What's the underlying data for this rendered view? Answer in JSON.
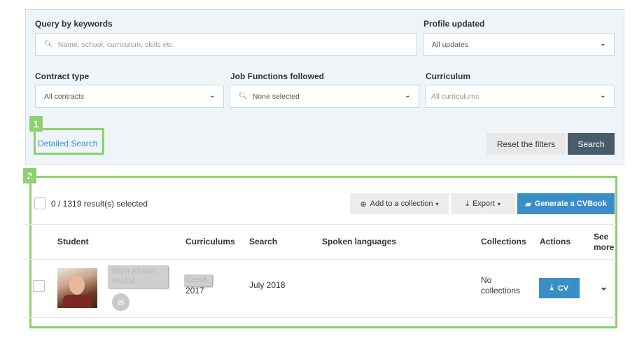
{
  "filters": {
    "query_label": "Query by keywords",
    "query_placeholder": "Name, school, curriculum, skills etc.",
    "profile_label": "Profile updated",
    "profile_value": "All updates",
    "contract_label": "Contract type",
    "contract_value": "All contracts",
    "job_label": "Job Functions followed",
    "job_value": "None selected",
    "curriculum_label": "Curriculum",
    "curriculum_value": "All curriculums",
    "detailed_link": "Detailed Search",
    "reset_label": "Reset the filters",
    "search_label": "Search"
  },
  "annotations": {
    "badge1": "1",
    "badge2": "2"
  },
  "toolbar": {
    "selected_count": "0 / 1319 result(s) selected",
    "add_collection": "Add to a collection",
    "export": "Export",
    "generate": "Generate a CVBook"
  },
  "table": {
    "headers": [
      "Student",
      "Curriculums",
      "Search",
      "Spoken languages",
      "Collections",
      "Actions",
      "See more"
    ],
    "row": {
      "name_line1": "Minh-Khanh",
      "name_line2": "PHAM",
      "curriculum_tag": "Celsa",
      "year": "2017",
      "search": "July 2018",
      "collections": "No collections",
      "cv_button": "CV"
    }
  },
  "colors": {
    "accent": "#3a8ec8",
    "annotation": "#8bd16e",
    "search_btn": "#4a5c6a"
  },
  "icons": [
    "search-icon",
    "chevron-down-icon",
    "envelope-icon",
    "download-icon",
    "plus-circle-icon",
    "book-icon"
  ]
}
